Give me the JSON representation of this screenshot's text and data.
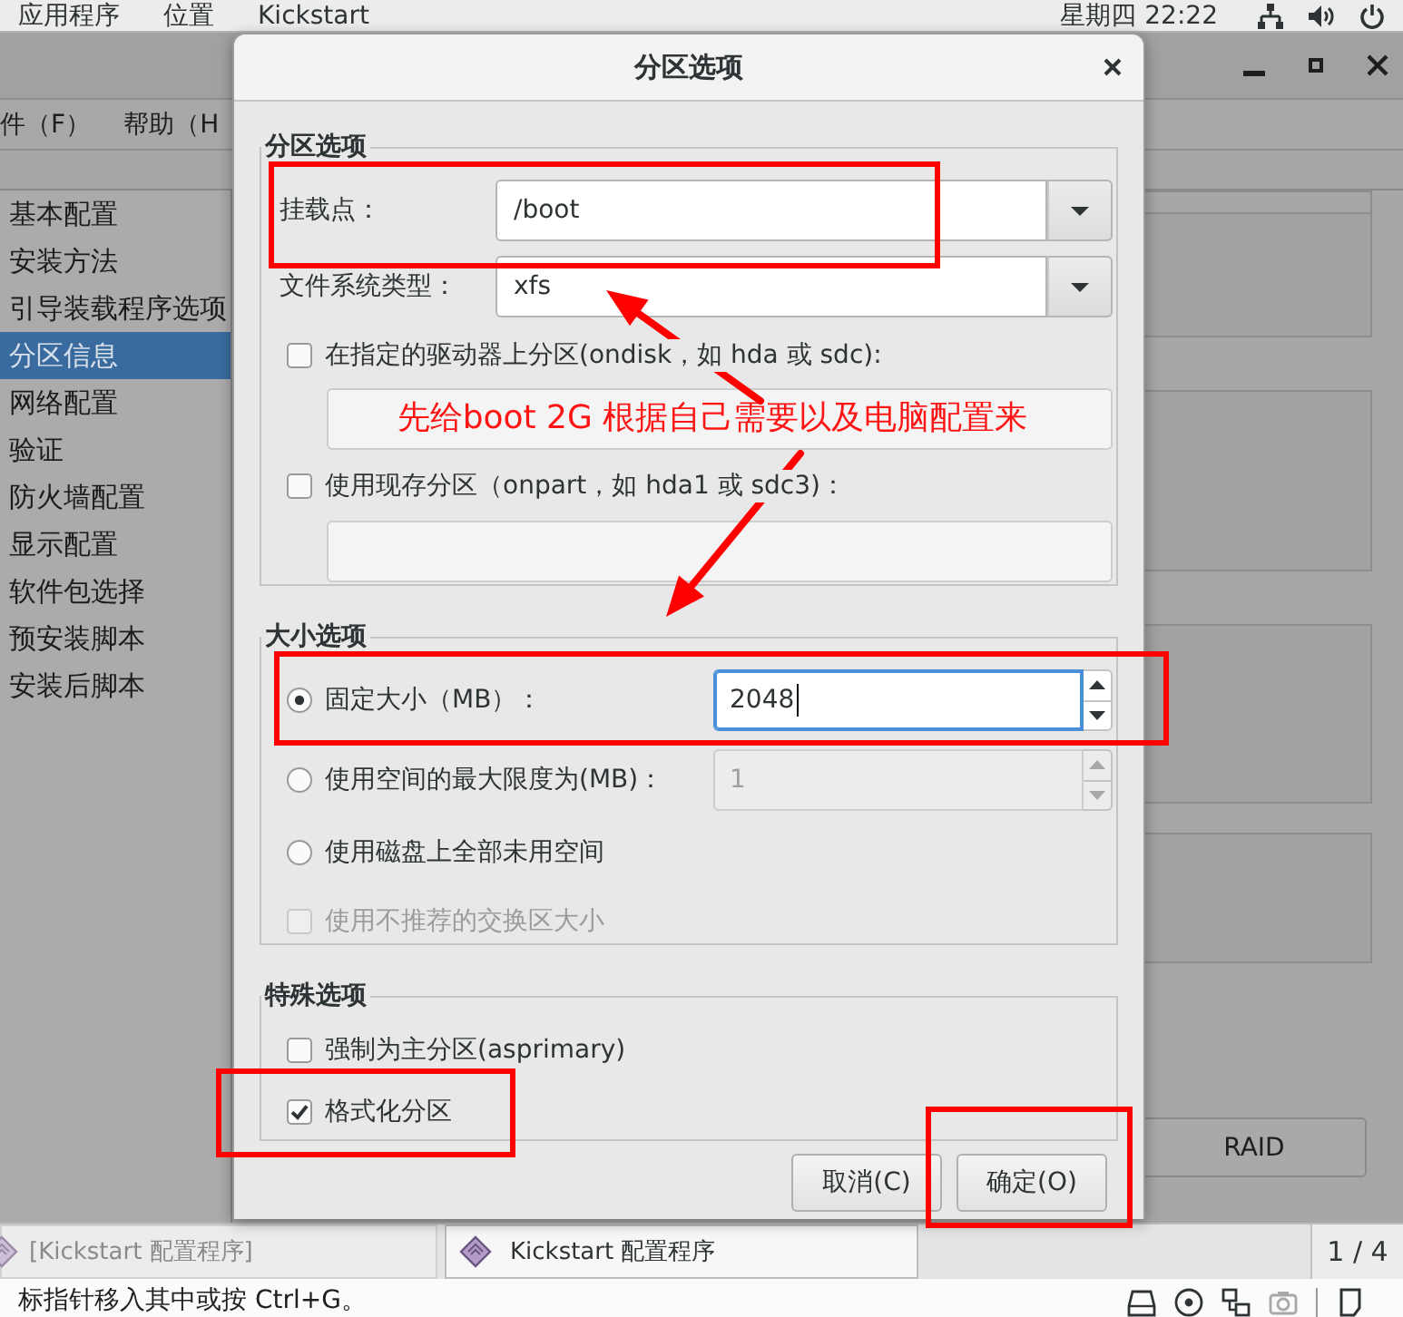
{
  "top_bar": {
    "menus": [
      "应用程序",
      "位置",
      "Kickstart"
    ],
    "clock": "星期四 22:22"
  },
  "main_window": {
    "menu": [
      "件（F）",
      "帮助（H"
    ],
    "sidebar": [
      {
        "label": "基本配置",
        "selected": false
      },
      {
        "label": "安装方法",
        "selected": false
      },
      {
        "label": "引导装载程序选项",
        "selected": false
      },
      {
        "label": "分区信息",
        "selected": true
      },
      {
        "label": "网络配置",
        "selected": false
      },
      {
        "label": "验证",
        "selected": false
      },
      {
        "label": "防火墙配置",
        "selected": false
      },
      {
        "label": "显示配置",
        "selected": false
      },
      {
        "label": "软件包选择",
        "selected": false
      },
      {
        "label": "预安装脚本",
        "selected": false
      },
      {
        "label": "安装后脚本",
        "selected": false
      }
    ],
    "raid_button": "RAID"
  },
  "dialog": {
    "title": "分区选项",
    "partition_group": {
      "legend": "分区选项",
      "fields": [
        {
          "label": "挂载点：",
          "value": "/boot"
        },
        {
          "label": "文件系统类型：",
          "value": "xfs"
        }
      ],
      "options": [
        {
          "label": "在指定的驱动器上分区(ondisk，如 hda 或 sdc):",
          "checked": false,
          "field_disabled": true
        },
        {
          "label": "使用现存分区（onpart，如 hda1 或 sdc3)：",
          "checked": false,
          "field_disabled": true
        }
      ]
    },
    "size_group": {
      "legend": "大小选项",
      "options": [
        {
          "kind": "radio",
          "label": "固定大小（MB）：",
          "selected": true,
          "disabled": false,
          "spin": {
            "value": "2048",
            "focused": true,
            "disabled": false
          }
        },
        {
          "kind": "radio",
          "label": "使用空间的最大限度为(MB)：",
          "selected": false,
          "disabled": false,
          "spin": {
            "value": "1",
            "focused": false,
            "disabled": true
          }
        },
        {
          "kind": "radio",
          "label": "使用磁盘上全部未用空间",
          "selected": false,
          "disabled": false
        },
        {
          "kind": "checkbox",
          "label": "使用不推荐的交换区大小",
          "checked": false,
          "disabled": true
        }
      ]
    },
    "special_group": {
      "legend": "特殊选项",
      "options": [
        {
          "label": "强制为主分区(asprimary)",
          "checked": false
        },
        {
          "label": "格式化分区",
          "checked": true
        }
      ]
    },
    "buttons": [
      "取消(C)",
      "确定(O)"
    ]
  },
  "taskbar": {
    "items": [
      {
        "label": "[Kickstart 配置程序]",
        "selected": false
      },
      {
        "label": "Kickstart 配置程序",
        "selected": true
      }
    ],
    "pager": "1 / 4"
  },
  "status_bar": {
    "text": "标指针移入其中或按 Ctrl+G。"
  },
  "annotation": {
    "note": "先给boot 2G 根据自己需要以及电脑配置来"
  }
}
